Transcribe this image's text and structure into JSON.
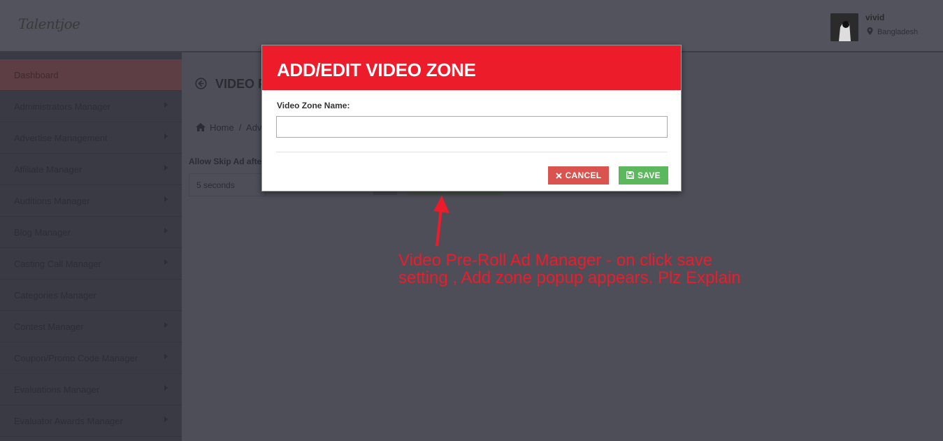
{
  "header": {
    "logo": "Talentjoe",
    "user_name": "vivid",
    "user_location": "Bangladesh"
  },
  "sidebar": {
    "items": [
      {
        "label": "Dashboard",
        "active": true,
        "has_children": false
      },
      {
        "label": "Administrators Manager",
        "has_children": true
      },
      {
        "label": "Advertise Management",
        "has_children": true
      },
      {
        "label": "Affiliate Manager",
        "has_children": true
      },
      {
        "label": "Auditions Manager",
        "has_children": true
      },
      {
        "label": "Blog Manager",
        "has_children": true
      },
      {
        "label": "Casting Call Manager",
        "has_children": true
      },
      {
        "label": "Categories Manager",
        "has_children": false
      },
      {
        "label": "Contest Manager",
        "has_children": true
      },
      {
        "label": "Coupon/Promo Code Manager",
        "has_children": true
      },
      {
        "label": "Evaluations Manager",
        "has_children": true
      },
      {
        "label": "Evaluator Awards Manager",
        "has_children": true
      }
    ]
  },
  "main": {
    "page_title": "VIDEO P",
    "breadcrumb": "Home  /  Adv",
    "skip_label": "Allow Skip Ad afte",
    "skip_value": "5 seconds"
  },
  "modal": {
    "title": "ADD/EDIT VIDEO ZONE",
    "field_label": "Video Zone Name:",
    "field_value": "",
    "field_placeholder": "",
    "cancel_label": "CANCEL",
    "save_label": "SAVE"
  },
  "annotation": {
    "text": "Video Pre-Roll Ad Manager - on click save setting , Add zone popup appears. Plz Explain"
  },
  "colors": {
    "modal_header": "#ec1c2a",
    "cancel": "#d9534f",
    "save": "#5cb85c",
    "annotation": "#ec1c2a"
  }
}
